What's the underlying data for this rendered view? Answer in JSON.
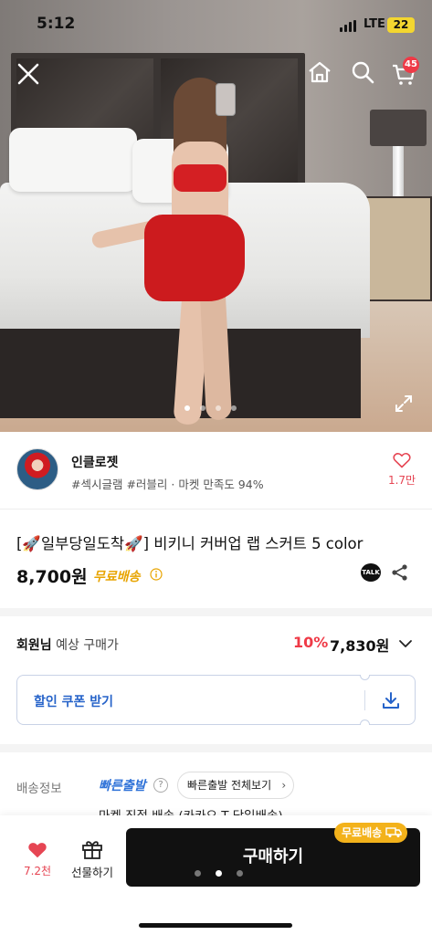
{
  "status_bar": {
    "time": "5:12",
    "network": "LTE",
    "battery": "22"
  },
  "header": {
    "cart_count": "45"
  },
  "gallery": {
    "total_images": 4,
    "current_index": 1
  },
  "seller": {
    "name": "인클로젯",
    "tags": "#섹시글램 #러블리 · 마켓 만족도 94%",
    "likes": "1.7만"
  },
  "product": {
    "title": "[🚀일부당일도착🚀] 비키니 커버업 랩 스커트 5 color",
    "price": "8,700원",
    "shipping_badge": "무료배송",
    "talk_label": "TALK"
  },
  "member_price": {
    "label_bold": "회원님",
    "label_rest": " 예상 구매가",
    "discount": "10%",
    "price": "7,830원"
  },
  "coupon": {
    "label": "할인 쿠폰 받기"
  },
  "shipping": {
    "label": "배송정보",
    "fast_label": "빠른출발",
    "help": "?",
    "view_all": "빠른출발 전체보기",
    "arrow": "›",
    "detail": "마켓 직접 배송 (카카오 T 당일배송)"
  },
  "bottom_bar": {
    "like_count": "7.2천",
    "gift_label": "선물하기",
    "buy_label": "구매하기",
    "buy_badge": "무료배송",
    "pager_total": 3,
    "pager_current": 1
  },
  "colors": {
    "accent_red": "#ef3a47",
    "like_pink": "#e64553",
    "free_ship_yellow": "#e8a400",
    "link_blue": "#2663c9",
    "buy_black": "#111111"
  }
}
